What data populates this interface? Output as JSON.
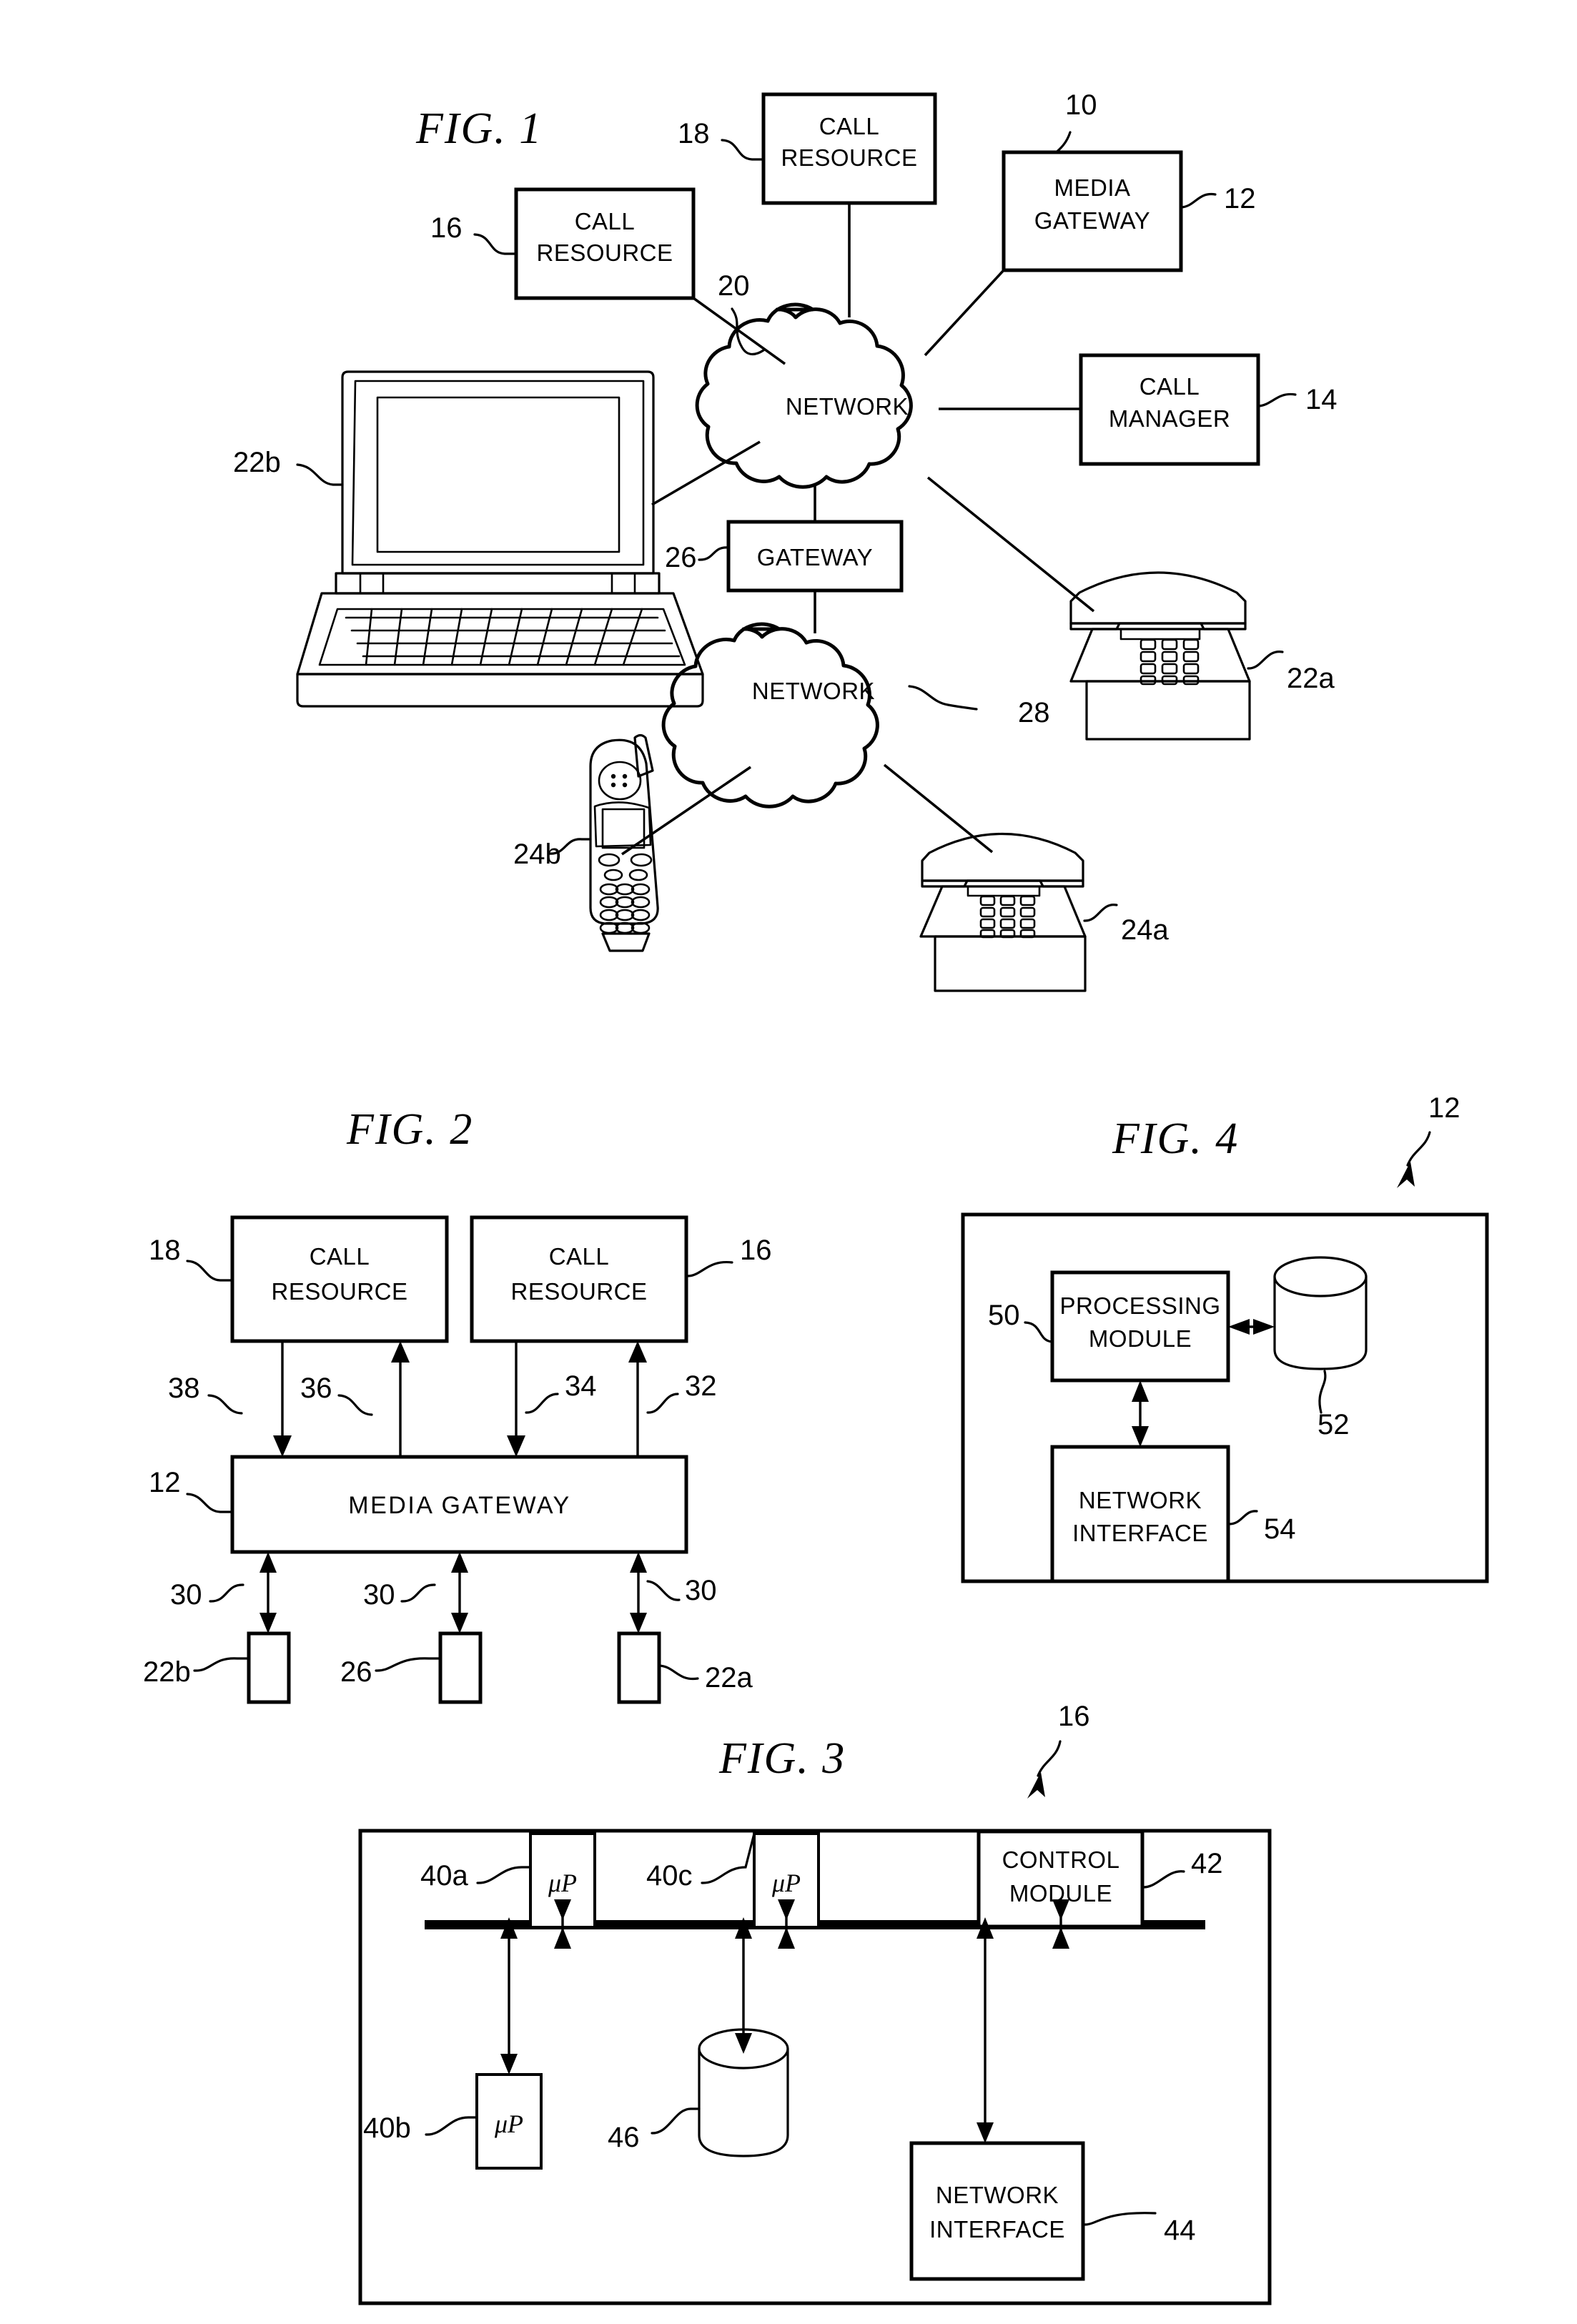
{
  "sheet": {
    "background": "#ffffff",
    "ink": "#000000"
  },
  "figures": [
    {
      "id": "fig1",
      "title": "FIG.  1",
      "system_ref": "10",
      "boxes": [
        {
          "ref": "16",
          "lines": [
            "CALL",
            "RESOURCE"
          ]
        },
        {
          "ref": "18",
          "lines": [
            "CALL",
            "RESOURCE"
          ]
        },
        {
          "ref": "12",
          "lines": [
            "MEDIA",
            "GATEWAY"
          ]
        },
        {
          "ref": "14",
          "lines": [
            "CALL",
            "MANAGER"
          ]
        },
        {
          "ref": "26",
          "lines": [
            "GATEWAY"
          ]
        }
      ],
      "clouds": [
        {
          "ref": "20",
          "label": "NETWORK"
        },
        {
          "ref": "28",
          "label": "NETWORK"
        }
      ],
      "endpoints": [
        {
          "ref": "22b",
          "kind": "laptop-icon"
        },
        {
          "ref": "22a",
          "kind": "desk-phone-icon"
        },
        {
          "ref": "24b",
          "kind": "mobile-phone-icon"
        },
        {
          "ref": "24a",
          "kind": "desk-phone-icon"
        }
      ]
    },
    {
      "id": "fig2",
      "title": "FIG.  2",
      "boxes": [
        {
          "ref": "18",
          "lines": [
            "CALL",
            "RESOURCE"
          ]
        },
        {
          "ref": "16",
          "lines": [
            "CALL",
            "RESOURCE"
          ]
        },
        {
          "ref": "12",
          "lines": [
            "MEDIA  GATEWAY"
          ]
        }
      ],
      "arrow_refs": [
        "38",
        "36",
        "34",
        "32"
      ],
      "link_refs": [
        "30",
        "30",
        "30"
      ],
      "terminal_refs": [
        "22b",
        "26",
        "22a"
      ]
    },
    {
      "id": "fig3",
      "title": "FIG.  3",
      "device_ref": "16",
      "processors": [
        {
          "ref": "40a",
          "label": "μP"
        },
        {
          "ref": "40c",
          "label": "μP"
        },
        {
          "ref": "40b",
          "label": "μP"
        }
      ],
      "boxes": [
        {
          "ref": "42",
          "lines": [
            "CONTROL",
            "MODULE"
          ]
        },
        {
          "ref": "44",
          "lines": [
            "NETWORK",
            "INTERFACE"
          ]
        }
      ],
      "storage": {
        "ref": "46",
        "kind": "database-cylinder-icon"
      }
    },
    {
      "id": "fig4",
      "title": "FIG.  4",
      "device_ref": "12",
      "boxes": [
        {
          "ref": "50",
          "lines": [
            "PROCESSING",
            "MODULE"
          ]
        },
        {
          "ref": "54",
          "lines": [
            "NETWORK",
            "INTERFACE"
          ]
        }
      ],
      "storage": {
        "ref": "52",
        "kind": "database-cylinder-icon"
      }
    }
  ],
  "fig1": {
    "title": "FIG.  1",
    "ref_10": "10",
    "ref_12": "12",
    "ref_14": "14",
    "ref_16": "16",
    "ref_18": "18",
    "ref_20": "20",
    "ref_22a": "22a",
    "ref_22b": "22b",
    "ref_24a": "24a",
    "ref_24b": "24b",
    "ref_26": "26",
    "ref_28": "28",
    "call_resource_16_l1": "CALL",
    "call_resource_16_l2": "RESOURCE",
    "call_resource_18_l1": "CALL",
    "call_resource_18_l2": "RESOURCE",
    "media_gateway_l1": "MEDIA",
    "media_gateway_l2": "GATEWAY",
    "call_manager_l1": "CALL",
    "call_manager_l2": "MANAGER",
    "gateway_label": "GATEWAY",
    "network_20_label": "NETWORK",
    "network_28_label": "NETWORK"
  },
  "fig2": {
    "title": "FIG.  2",
    "ref_12": "12",
    "ref_16": "16",
    "ref_18": "18",
    "ref_32": "32",
    "ref_34": "34",
    "ref_36": "36",
    "ref_38": "38",
    "ref_30a": "30",
    "ref_30b": "30",
    "ref_30c": "30",
    "ref_22a": "22a",
    "ref_22b": "22b",
    "ref_26": "26",
    "call_resource_18_l1": "CALL",
    "call_resource_18_l2": "RESOURCE",
    "call_resource_16_l1": "CALL",
    "call_resource_16_l2": "RESOURCE",
    "media_gateway_label": "MEDIA  GATEWAY"
  },
  "fig3": {
    "title": "FIG.  3",
    "ref_16": "16",
    "ref_40a": "40a",
    "ref_40b": "40b",
    "ref_40c": "40c",
    "ref_42": "42",
    "ref_44": "44",
    "ref_46": "46",
    "up_a": "μP",
    "up_b": "μP",
    "up_c": "μP",
    "control_module_l1": "CONTROL",
    "control_module_l2": "MODULE",
    "network_interface_l1": "NETWORK",
    "network_interface_l2": "INTERFACE"
  },
  "fig4": {
    "title": "FIG.  4",
    "ref_12": "12",
    "ref_50": "50",
    "ref_52": "52",
    "ref_54": "54",
    "processing_module_l1": "PROCESSING",
    "processing_module_l2": "MODULE",
    "network_interface_l1": "NETWORK",
    "network_interface_l2": "INTERFACE"
  }
}
